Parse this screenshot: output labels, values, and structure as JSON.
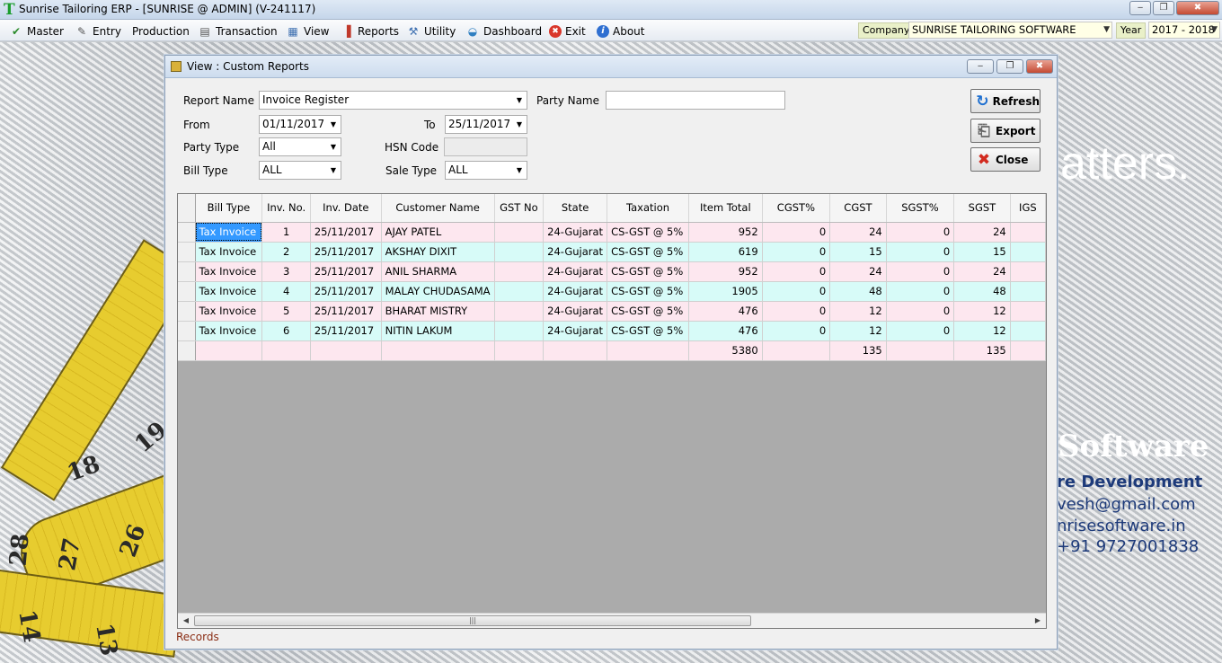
{
  "app": {
    "title": "Sunrise Tailoring ERP - [SUNRISE @ ADMIN] (V-241117)",
    "window_controls": [
      "‒",
      "❐",
      "✖"
    ]
  },
  "menu": {
    "items": [
      {
        "label": "Master",
        "icon": "✔"
      },
      {
        "label": "Entry",
        "icon": "✎"
      },
      {
        "label": "Production",
        "icon": ""
      },
      {
        "label": "Transaction",
        "icon": "▤"
      },
      {
        "label": "View",
        "icon": "▦"
      },
      {
        "label": "Reports",
        "icon": "▐"
      },
      {
        "label": "Utility",
        "icon": "⚒"
      },
      {
        "label": "Dashboard",
        "icon": "◒"
      },
      {
        "label": "Exit",
        "icon": "✖"
      },
      {
        "label": "About",
        "icon": "i"
      }
    ],
    "company_label": "Company",
    "company_value": "SUNRISE TAILORING SOFTWARE",
    "year_label": "Year",
    "year_value": "2017 - 2018"
  },
  "background": {
    "tagline": "atters.",
    "brand": "Software",
    "line1": "re Development",
    "line2": "vesh@gmail.com",
    "line3": "nrisesoftware.in",
    "line4": "+91 9727001838",
    "tape_numbers": [
      "18",
      "19",
      "26",
      "27",
      "28",
      "14",
      "13"
    ]
  },
  "window": {
    "title": "View : Custom Reports",
    "controls": [
      "‒",
      "❐",
      "✖"
    ]
  },
  "form": {
    "report_name_label": "Report Name",
    "report_name_value": "Invoice Register",
    "party_name_label": "Party Name",
    "party_name_value": "",
    "from_label": "From",
    "from_value": "01/11/2017",
    "to_label": "To",
    "to_value": "25/11/2017",
    "party_type_label": "Party Type",
    "party_type_value": "All",
    "hsn_label": "HSN Code",
    "hsn_value": "",
    "bill_type_label": "Bill Type",
    "bill_type_value": "ALL",
    "sale_type_label": "Sale Type",
    "sale_type_value": "ALL",
    "arrow": "▼"
  },
  "buttons": {
    "refresh": "Refresh",
    "export": "Export",
    "close": "Close",
    "refresh_icon": "↻",
    "export_icon": "⎗",
    "close_icon": "✖"
  },
  "grid": {
    "columns": [
      {
        "label": "Bill Type",
        "align": "left"
      },
      {
        "label": "Inv. No.",
        "align": "ctr"
      },
      {
        "label": "Inv. Date",
        "align": "left"
      },
      {
        "label": "Customer Name",
        "align": "left"
      },
      {
        "label": "GST No",
        "align": "left"
      },
      {
        "label": "State",
        "align": "left"
      },
      {
        "label": "Taxation",
        "align": "left"
      },
      {
        "label": "Item Total",
        "align": "num"
      },
      {
        "label": "CGST%",
        "align": "num"
      },
      {
        "label": "CGST",
        "align": "num"
      },
      {
        "label": "SGST%",
        "align": "num"
      },
      {
        "label": "SGST",
        "align": "num"
      },
      {
        "label": "IGS",
        "align": "num"
      }
    ],
    "rows": [
      [
        "Tax Invoice",
        "1",
        "25/11/2017",
        "AJAY PATEL",
        "",
        "24-Gujarat",
        "CS-GST @ 5%",
        "952",
        "0",
        "24",
        "0",
        "24",
        ""
      ],
      [
        "Tax Invoice",
        "2",
        "25/11/2017",
        "AKSHAY DIXIT",
        "",
        "24-Gujarat",
        "CS-GST @ 5%",
        "619",
        "0",
        "15",
        "0",
        "15",
        ""
      ],
      [
        "Tax Invoice",
        "3",
        "25/11/2017",
        "ANIL SHARMA",
        "",
        "24-Gujarat",
        "CS-GST @ 5%",
        "952",
        "0",
        "24",
        "0",
        "24",
        ""
      ],
      [
        "Tax Invoice",
        "4",
        "25/11/2017",
        "MALAY CHUDASAMA",
        "",
        "24-Gujarat",
        "CS-GST @ 5%",
        "1905",
        "0",
        "48",
        "0",
        "48",
        ""
      ],
      [
        "Tax Invoice",
        "5",
        "25/11/2017",
        "BHARAT MISTRY",
        "",
        "24-Gujarat",
        "CS-GST @ 5%",
        "476",
        "0",
        "12",
        "0",
        "12",
        ""
      ],
      [
        "Tax Invoice",
        "6",
        "25/11/2017",
        "NITIN LAKUM",
        "",
        "24-Gujarat",
        "CS-GST @ 5%",
        "476",
        "0",
        "12",
        "0",
        "12",
        ""
      ]
    ],
    "totals": [
      "",
      "",
      "",
      "",
      "",
      "",
      "",
      "5380",
      "",
      "135",
      "",
      "135",
      ""
    ],
    "scroll_left": "◀",
    "scroll_right": "▶",
    "scroll_grip": "|||"
  },
  "status": {
    "text": "Records"
  },
  "colors": {
    "row_odd": "#fde7ef",
    "row_even": "#d7fbf8",
    "selection": "#3399ff",
    "status_text": "#8a2d14",
    "brand_navy": "#1d3a7a"
  }
}
